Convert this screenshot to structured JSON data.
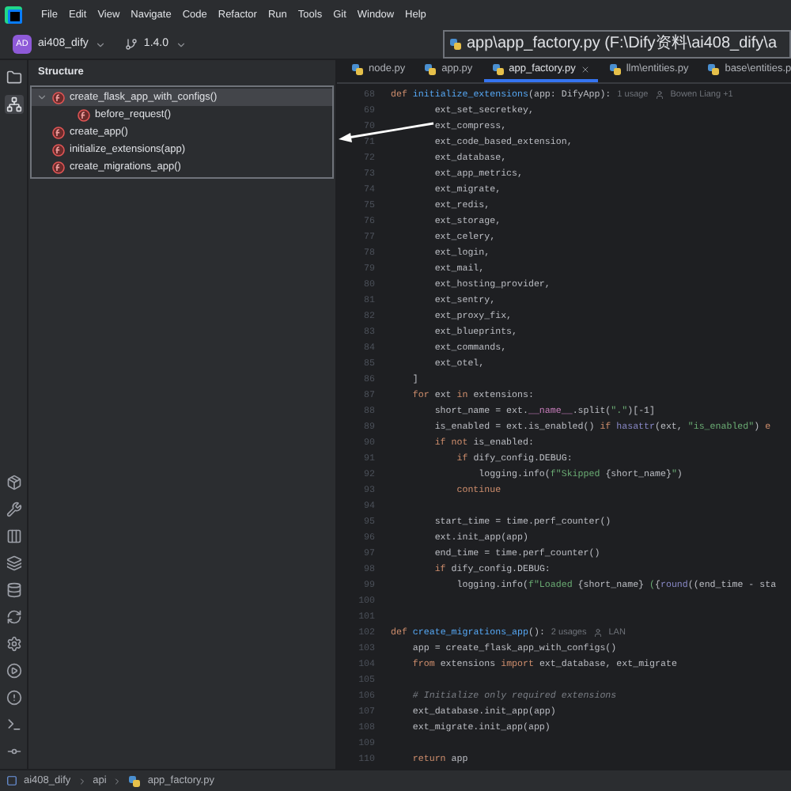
{
  "menu": [
    "File",
    "Edit",
    "View",
    "Navigate",
    "Code",
    "Refactor",
    "Run",
    "Tools",
    "Git",
    "Window",
    "Help"
  ],
  "toolbar": {
    "avatar": "AD",
    "project": "ai408_dify",
    "branch": "1.4.0"
  },
  "path_popup": {
    "text": "app\\app_factory.py (F:\\Dify资料\\ai408_dify\\a"
  },
  "structure": {
    "title": "Structure",
    "items": [
      {
        "label": "create_flask_app_with_configs()",
        "selected": true,
        "expanded": true,
        "children": [
          {
            "label": "before_request()",
            "selected": false
          }
        ]
      },
      {
        "label": "create_app()",
        "selected": false
      },
      {
        "label": "initialize_extensions(app)",
        "selected": false
      },
      {
        "label": "create_migrations_app()",
        "selected": false
      }
    ]
  },
  "tabs": [
    {
      "label": "node.py",
      "selected": false
    },
    {
      "label": "app.py",
      "selected": false
    },
    {
      "label": "app_factory.py",
      "selected": true
    },
    {
      "label": "llm\\entities.py",
      "selected": false
    },
    {
      "label": "base\\entities.p",
      "selected": false
    }
  ],
  "code": [
    {
      "number": "68",
      "tokens": [
        {
          "kind": "keyword",
          "text": "def "
        },
        {
          "kind": "function",
          "text": "initialize_extensions"
        },
        {
          "kind": "plain",
          "text": "(app: DifyApp):"
        }
      ],
      "hints": [
        "1 usage",
        "Bowen Liang +1"
      ]
    },
    {
      "number": "69",
      "tokens": [
        {
          "kind": "plain",
          "text": "        ext_set_secretkey,"
        }
      ]
    },
    {
      "number": "70",
      "tokens": [
        {
          "kind": "plain",
          "text": "        ext_compress,"
        }
      ]
    },
    {
      "number": "71",
      "tokens": [
        {
          "kind": "plain",
          "text": "        ext_code_based_extension,"
        }
      ]
    },
    {
      "number": "72",
      "tokens": [
        {
          "kind": "plain",
          "text": "        ext_database,"
        }
      ]
    },
    {
      "number": "73",
      "tokens": [
        {
          "kind": "plain",
          "text": "        ext_app_metrics,"
        }
      ]
    },
    {
      "number": "74",
      "tokens": [
        {
          "kind": "plain",
          "text": "        ext_migrate,"
        }
      ]
    },
    {
      "number": "75",
      "tokens": [
        {
          "kind": "plain",
          "text": "        ext_redis,"
        }
      ]
    },
    {
      "number": "76",
      "tokens": [
        {
          "kind": "plain",
          "text": "        ext_storage,"
        }
      ]
    },
    {
      "number": "77",
      "tokens": [
        {
          "kind": "plain",
          "text": "        ext_celery,"
        }
      ]
    },
    {
      "number": "78",
      "tokens": [
        {
          "kind": "plain",
          "text": "        ext_login,"
        }
      ]
    },
    {
      "number": "79",
      "tokens": [
        {
          "kind": "plain",
          "text": "        ext_mail,"
        }
      ]
    },
    {
      "number": "80",
      "tokens": [
        {
          "kind": "plain",
          "text": "        ext_hosting_provider,"
        }
      ]
    },
    {
      "number": "81",
      "tokens": [
        {
          "kind": "plain",
          "text": "        ext_sentry,"
        }
      ]
    },
    {
      "number": "82",
      "tokens": [
        {
          "kind": "plain",
          "text": "        ext_proxy_fix,"
        }
      ]
    },
    {
      "number": "83",
      "tokens": [
        {
          "kind": "plain",
          "text": "        ext_blueprints,"
        }
      ]
    },
    {
      "number": "84",
      "tokens": [
        {
          "kind": "plain",
          "text": "        ext_commands,"
        }
      ]
    },
    {
      "number": "85",
      "tokens": [
        {
          "kind": "plain",
          "text": "        ext_otel,"
        }
      ]
    },
    {
      "number": "86",
      "tokens": [
        {
          "kind": "plain",
          "text": "    ]"
        }
      ]
    },
    {
      "number": "87",
      "tokens": [
        {
          "kind": "keyword",
          "text": "    for "
        },
        {
          "kind": "plain",
          "text": "ext "
        },
        {
          "kind": "keyword",
          "text": "in "
        },
        {
          "kind": "plain",
          "text": "extensions:"
        }
      ]
    },
    {
      "number": "88",
      "tokens": [
        {
          "kind": "plain",
          "text": "        short_name = ext."
        },
        {
          "kind": "dunder",
          "text": "__name__"
        },
        {
          "kind": "plain",
          "text": ".split("
        },
        {
          "kind": "string",
          "text": "\".\""
        },
        {
          "kind": "plain",
          "text": ")[-1]"
        }
      ]
    },
    {
      "number": "89",
      "tokens": [
        {
          "kind": "plain",
          "text": "        is_enabled = ext.is_enabled() "
        },
        {
          "kind": "keyword",
          "text": "if "
        },
        {
          "kind": "builtin",
          "text": "hasattr"
        },
        {
          "kind": "plain",
          "text": "(ext, "
        },
        {
          "kind": "string",
          "text": "\"is_enabled\""
        },
        {
          "kind": "plain",
          "text": ") "
        },
        {
          "kind": "keyword",
          "text": "e"
        }
      ]
    },
    {
      "number": "90",
      "tokens": [
        {
          "kind": "keyword",
          "text": "        if not "
        },
        {
          "kind": "plain",
          "text": "is_enabled:"
        }
      ]
    },
    {
      "number": "91",
      "tokens": [
        {
          "kind": "keyword",
          "text": "            if "
        },
        {
          "kind": "plain",
          "text": "dify_config.DEBUG:"
        }
      ]
    },
    {
      "number": "92",
      "tokens": [
        {
          "kind": "plain",
          "text": "                logging.info("
        },
        {
          "kind": "string",
          "text": "f\"Skipped "
        },
        {
          "kind": "plain",
          "text": "{short_name}"
        },
        {
          "kind": "string",
          "text": "\""
        },
        {
          "kind": "plain",
          "text": ")"
        }
      ]
    },
    {
      "number": "93",
      "tokens": [
        {
          "kind": "keyword",
          "text": "            continue"
        }
      ]
    },
    {
      "number": "94"
    },
    {
      "number": "95",
      "tokens": [
        {
          "kind": "plain",
          "text": "        start_time = time.perf_counter()"
        }
      ]
    },
    {
      "number": "96",
      "tokens": [
        {
          "kind": "plain",
          "text": "        ext.init_app(app)"
        }
      ]
    },
    {
      "number": "97",
      "tokens": [
        {
          "kind": "plain",
          "text": "        end_time = time.perf_counter()"
        }
      ]
    },
    {
      "number": "98",
      "tokens": [
        {
          "kind": "keyword",
          "text": "        if "
        },
        {
          "kind": "plain",
          "text": "dify_config.DEBUG:"
        }
      ]
    },
    {
      "number": "99",
      "tokens": [
        {
          "kind": "plain",
          "text": "            logging.info("
        },
        {
          "kind": "string",
          "text": "f\"Loaded "
        },
        {
          "kind": "plain",
          "text": "{short_name} "
        },
        {
          "kind": "string",
          "text": "("
        },
        {
          "kind": "plain",
          "text": "{"
        },
        {
          "kind": "builtin",
          "text": "round"
        },
        {
          "kind": "plain",
          "text": "((end_time - sta"
        }
      ]
    },
    {
      "number": "100"
    },
    {
      "number": "101"
    },
    {
      "number": "102",
      "tokens": [
        {
          "kind": "keyword",
          "text": "def "
        },
        {
          "kind": "function",
          "text": "create_migrations_app"
        },
        {
          "kind": "plain",
          "text": "():"
        }
      ],
      "hints": [
        "2 usages",
        "LAN"
      ]
    },
    {
      "number": "103",
      "tokens": [
        {
          "kind": "plain",
          "text": "    app = create_flask_app_with_configs()"
        }
      ]
    },
    {
      "number": "104",
      "tokens": [
        {
          "kind": "keyword",
          "text": "    from "
        },
        {
          "kind": "plain",
          "text": "extensions "
        },
        {
          "kind": "keyword",
          "text": "import "
        },
        {
          "kind": "plain",
          "text": "ext_database, ext_migrate"
        }
      ]
    },
    {
      "number": "105"
    },
    {
      "number": "106",
      "tokens": [
        {
          "kind": "comment",
          "text": "    # Initialize only required extensions"
        }
      ]
    },
    {
      "number": "107",
      "tokens": [
        {
          "kind": "plain",
          "text": "    ext_database.init_app(app)"
        }
      ]
    },
    {
      "number": "108",
      "tokens": [
        {
          "kind": "plain",
          "text": "    ext_migrate.init_app(app)"
        }
      ]
    },
    {
      "number": "109"
    },
    {
      "number": "110",
      "tokens": [
        {
          "kind": "keyword",
          "text": "    return "
        },
        {
          "kind": "plain",
          "text": "app"
        }
      ]
    }
  ],
  "breadcrumb": [
    "ai408_dify",
    "api",
    "app_factory.py"
  ]
}
